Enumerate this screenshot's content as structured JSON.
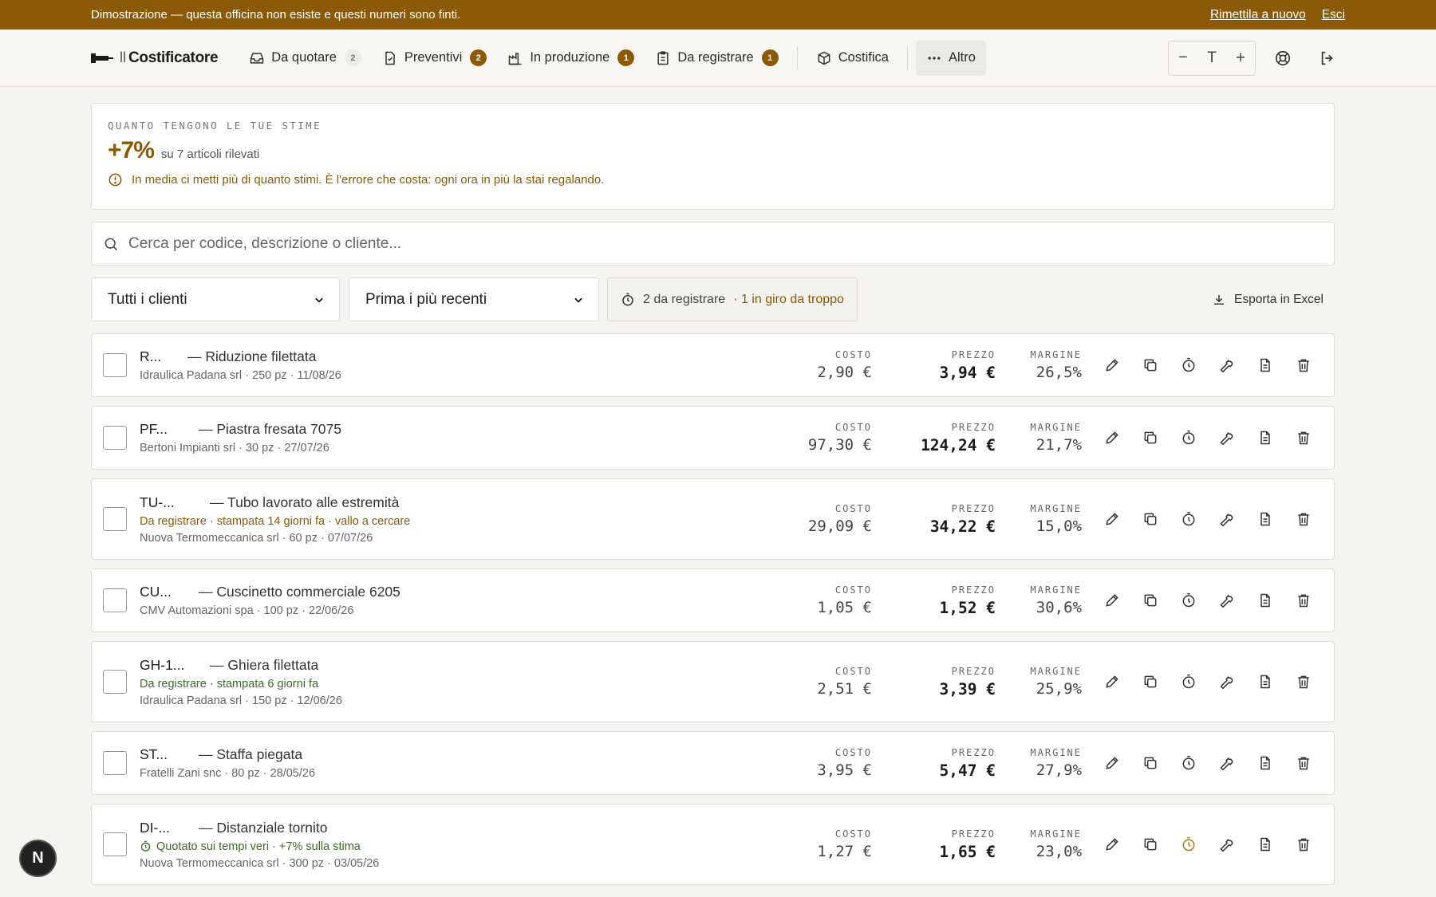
{
  "demo_bar": {
    "message": "Dimostrazione — questa officina non esiste e questi numeri sono finti.",
    "reset_label": "Rimettila a nuovo",
    "exit_label": "Esci",
    "color": "#8a5a08"
  },
  "nav": {
    "brand_prefix": "ll",
    "brand": "Costificatore",
    "items": [
      {
        "label": "Da quotare",
        "count": "2",
        "icon": "inbox-icon"
      },
      {
        "label": "Preventivi",
        "count": "2",
        "icon": "document-check-icon"
      },
      {
        "label": "In produzione",
        "count": "1",
        "icon": "factory-icon"
      },
      {
        "label": "Da registrare",
        "count": "1",
        "icon": "clipboard-icon"
      },
      {
        "label": "Costifica",
        "icon": "box-icon"
      },
      {
        "label": "Altro",
        "icon": "more-dots-icon"
      }
    ],
    "font_controls": [
      "−",
      "T",
      "+"
    ]
  },
  "estimate": {
    "eyebrow": "QUANTO TENGONO LE TUE STIME",
    "value": "+7%",
    "sub": "su 7 articoli rilevati",
    "warning": "In media ci metti più di quanto stimi. È l'errore che costa: ogni ora in più la stai regalando."
  },
  "search": {
    "placeholder": "Cerca per codice, descrizione o cliente..."
  },
  "filters": {
    "client": "Tutti i clienti",
    "sort": "Prima i più recenti",
    "status_count": "2 da registrare",
    "status_late": "· 1 in giro da troppo",
    "export_label": "Esporta in Excel"
  },
  "labels": {
    "cost": "COSTO",
    "price": "PREZZO",
    "margin": "MARGINE"
  },
  "rows": [
    {
      "code": "R...",
      "desc": "— Riduzione filettata",
      "sub": "Idraulica Padana srl · 250 pz · 11/08/26",
      "flag": "",
      "cost": "2,90 €",
      "price": "3,94 €",
      "margin": "26,5%"
    },
    {
      "code": "PF...",
      "desc": "— Piastra fresata 7075",
      "sub": "Bertoni Impianti srl · 30 pz · 27/07/26",
      "flag": "",
      "cost": "97,30 €",
      "price": "124,24 €",
      "margin": "21,7%"
    },
    {
      "code": "TU-...",
      "desc": "— Tubo lavorato alle estremità",
      "sub": "Nuova Termomeccanica srl · 60 pz · 07/07/26",
      "flag": "Da registrare · stampata 14 giorni fa · vallo a cercare",
      "cost": "29,09 €",
      "price": "34,22 €",
      "margin": "15,0%"
    },
    {
      "code": "CU...",
      "desc": "— Cuscinetto commerciale 6205",
      "sub": "CMV Automazioni spa · 100 pz · 22/06/26",
      "flag": "",
      "cost": "1,05 €",
      "price": "1,52 €",
      "margin": "30,6%"
    },
    {
      "code": "GH-1...",
      "desc": "— Ghiera filettata",
      "sub": "Idraulica Padana srl · 150 pz · 12/06/26",
      "flag": "Da registrare · stampata 6 giorni fa",
      "cost": "2,51 €",
      "price": "3,39 €",
      "margin": "25,9%"
    },
    {
      "code": "ST...",
      "desc": "— Staffa piegata",
      "sub": "Fratelli Zani snc · 80 pz · 28/05/26",
      "flag": "",
      "cost": "3,95 €",
      "price": "5,47 €",
      "margin": "27,9%"
    },
    {
      "code": "DI-...",
      "desc": "— Distanziale tornito",
      "sub": "Nuova Termomeccanica srl · 300 pz · 03/05/26",
      "flag": "Quotato sui tempi veri · +7% sulla stima",
      "cost": "1,27 €",
      "price": "1,65 €",
      "margin": "23,0%"
    }
  ],
  "fab": {
    "letter": "N"
  }
}
